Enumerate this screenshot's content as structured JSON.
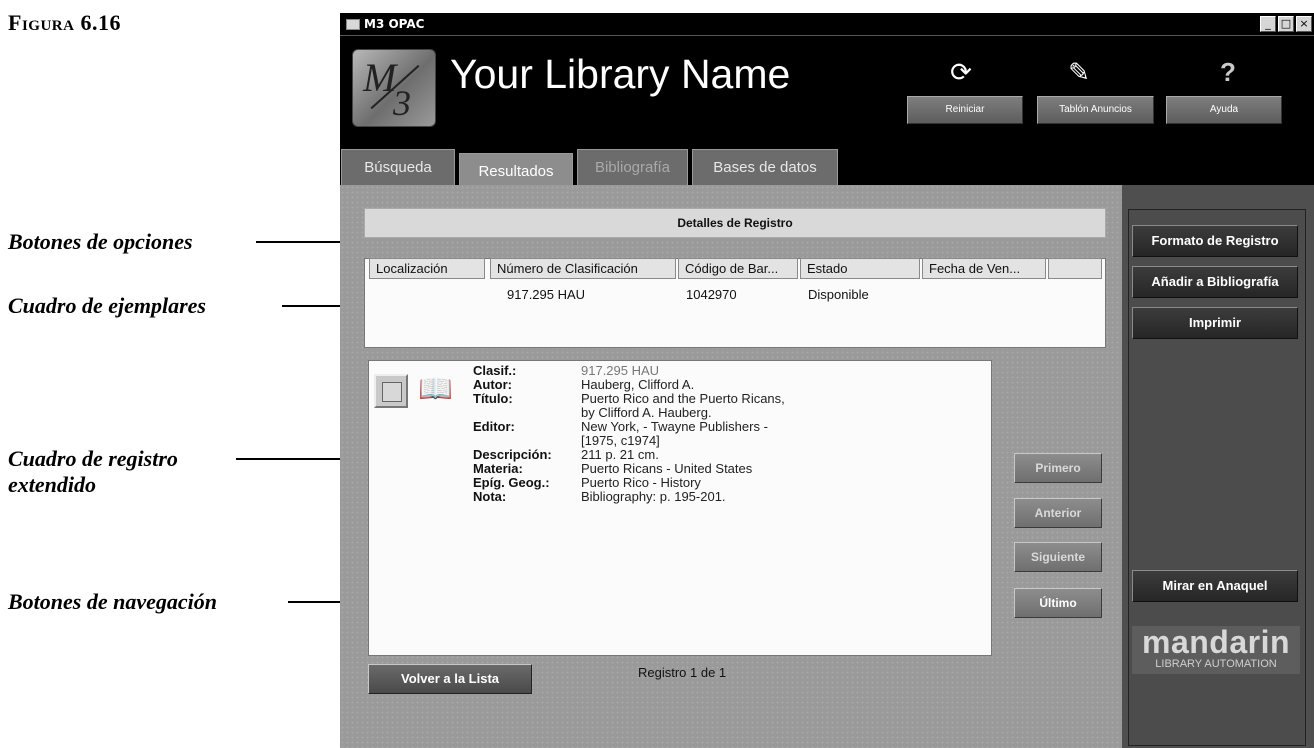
{
  "figure_label": "Figura 6.16",
  "annotations": [
    {
      "text": "Botones de opciones"
    },
    {
      "text": "Cuadro de ejemplares"
    },
    {
      "text": "Cuadro de registro",
      "text2": "extendido"
    },
    {
      "text": "Botones de navegación"
    }
  ],
  "window": {
    "title": "M3 OPAC",
    "controls": [
      "_",
      "□",
      "×"
    ]
  },
  "header": {
    "logo_text_top": "M",
    "logo_text_bottom": "3",
    "library_name": "Your Library Name",
    "buttons": [
      {
        "label": "Reiniciar",
        "icon": "refresh-icon",
        "glyph": "⟳"
      },
      {
        "label": "Tablón Anuncios",
        "icon": "notepad-icon",
        "glyph": "✎"
      },
      {
        "label": "Ayuda",
        "icon": "help-icon",
        "glyph": "?"
      }
    ]
  },
  "tabs": [
    {
      "label": "Búsqueda",
      "state": "normal"
    },
    {
      "label": "Resultados",
      "state": "active"
    },
    {
      "label": "Bibliografía",
      "state": "disabled"
    },
    {
      "label": "Bases de datos",
      "state": "normal"
    }
  ],
  "details": {
    "header": "Detalles de Registro",
    "columns": [
      "Localización",
      "Número de Clasificación",
      "Código de Bar...",
      "Estado",
      "Fecha de Ven..."
    ],
    "rows": [
      [
        "",
        "917.295 HAU",
        "1042970",
        "Disponible",
        ""
      ]
    ]
  },
  "record": {
    "fields": [
      {
        "label": "Clasif.:",
        "value": [
          "917.295 HAU"
        ]
      },
      {
        "label": "Autor:",
        "value": [
          "Hauberg, Clifford A."
        ]
      },
      {
        "label": "Título:",
        "value": [
          "Puerto Rico and the Puerto Ricans,",
          "by Clifford A. Hauberg."
        ]
      },
      {
        "label": "Editor:",
        "value": [
          "New York, - Twayne Publishers -",
          "[1975, c1974]"
        ]
      },
      {
        "label": "Descripción:",
        "value": [
          "211 p. 21 cm."
        ]
      },
      {
        "label": "Materia:",
        "value": [
          "Puerto Ricans - United States"
        ]
      },
      {
        "label": "Epíg. Geog.:",
        "value": [
          "Puerto Rico - History"
        ]
      },
      {
        "label": "Nota:",
        "value": [
          "Bibliography: p. 195-201."
        ]
      }
    ]
  },
  "navigation": {
    "first": "Primero",
    "previous": "Anterior",
    "next": "Siguiente",
    "last": "Último"
  },
  "footer": {
    "back_button": "Volver a la Lista",
    "record_counter": "Registro 1 de 1"
  },
  "side_panel": {
    "options": [
      "Formato de Registro",
      "Añadir a Bibliografía",
      "Imprimir"
    ],
    "shelf_button": "Mirar en Anaquel",
    "brand_name": "mandarin",
    "brand_tagline": "LIBRARY AUTOMATION"
  }
}
